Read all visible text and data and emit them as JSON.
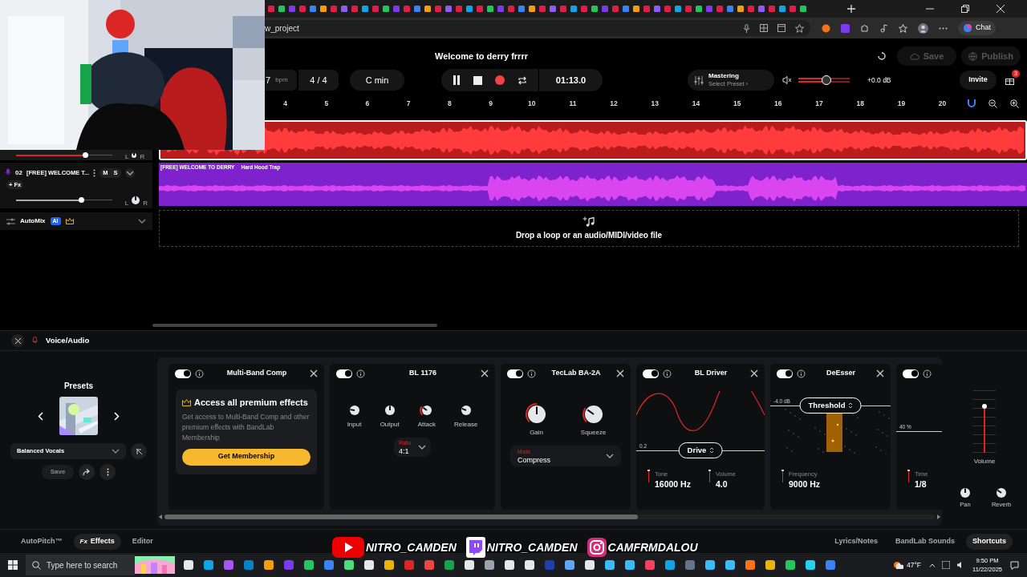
{
  "browser": {
    "address": "w_project",
    "chat": "Chat"
  },
  "project": {
    "title": "Welcome to derry frrrr",
    "save": "Save",
    "publish": "Publish"
  },
  "transport": {
    "tempo": "7",
    "tempo_unit": "bpm",
    "time_signature": "4 / 4",
    "key": "C min",
    "time": "01:13.0"
  },
  "mastering": {
    "title": "Mastering",
    "subtitle": "Select Preset ›"
  },
  "master_volume": {
    "level": 0.55,
    "reading": "+0.0 dB"
  },
  "invite": "Invite",
  "notifications": "3",
  "ruler": [
    "4",
    "5",
    "6",
    "7",
    "8",
    "9",
    "10",
    "11",
    "12",
    "13",
    "14",
    "15",
    "16",
    "17",
    "18",
    "19",
    "20"
  ],
  "tracks": [
    {
      "color": "#b91c1c",
      "selected": true,
      "volume": {
        "level": 0.72
      },
      "pan": [
        "L",
        "R"
      ]
    },
    {
      "color": "#7e22ce",
      "selected": false,
      "number": "02",
      "name": "[FREE] WELCOME T...",
      "mute": "M",
      "solo": "S",
      "fx": "+ Fx",
      "volume": {
        "level": 0.68
      },
      "pan": [
        "L",
        "R"
      ],
      "clip_title": "[FREE] WELCOME TO DERRY",
      "clip_subtitle": "Hard Hood Trap"
    }
  ],
  "automix": {
    "label": "AutoMix",
    "badge": "AI"
  },
  "drop_zone": "Drop a loop or an audio/MIDI/video file",
  "panel": {
    "title": "Voice/Audio"
  },
  "presets": {
    "title": "Presets",
    "selected": "Balanced Vocals",
    "save": "Save"
  },
  "effects": [
    {
      "kind": "premium",
      "name": "Multi-Band Comp",
      "on": true,
      "promo_title": "Access all premium effects",
      "promo_text": "Get access to Multi-Band Comp and other premium effects with BandLab Membership",
      "button": "Get Membership"
    },
    {
      "kind": "knobs",
      "name": "BL 1176",
      "on": true,
      "knobs": [
        {
          "label": "Input"
        },
        {
          "label": "Output"
        },
        {
          "label": "Attack"
        },
        {
          "label": "Release"
        }
      ],
      "select_label": "Ratio",
      "select_value": "4:1"
    },
    {
      "kind": "knobs",
      "name": "TecLab BA-2A",
      "on": true,
      "knobs": [
        {
          "label": "Gain"
        },
        {
          "label": "Squeeze"
        }
      ],
      "select_label": "Mode",
      "select_value": "Compress"
    },
    {
      "kind": "driver",
      "name": "BL Driver",
      "on": true,
      "reading": "0.2",
      "control": "Drive",
      "params": [
        {
          "label": "Tone",
          "value": "16000 Hz"
        },
        {
          "label": "Volume",
          "value": "4.0"
        }
      ]
    },
    {
      "kind": "deesser",
      "name": "DeEsser",
      "on": true,
      "reading": "-4.0 dB",
      "control": "Threshold",
      "params": [
        {
          "label": "Frequency",
          "value": "9000 Hz"
        }
      ]
    },
    {
      "kind": "partial",
      "on": true,
      "reading": "40 %",
      "params": [
        {
          "label": "Time",
          "value": "1/8"
        }
      ]
    }
  ],
  "channel": {
    "volume_label": "Volume",
    "volume": {
      "level": 0.75
    },
    "pan_label": "Pan",
    "reverb_label": "Reverb"
  },
  "bottom_tabs": [
    {
      "label": "AutoPitch™",
      "selected": false
    },
    {
      "label": "Effects",
      "prefix": "Fx",
      "selected": true
    },
    {
      "label": "Editor",
      "selected": false
    }
  ],
  "bottom_right": [
    {
      "label": "Lyrics/Notes",
      "selected": false
    },
    {
      "label": "BandLab Sounds",
      "selected": false
    },
    {
      "label": "Shortcuts",
      "selected": true
    }
  ],
  "socials": [
    {
      "kind": "youtube",
      "handle": "NITRO_CAMDEN"
    },
    {
      "kind": "twitch",
      "handle": "NITRO_CAMDEN"
    },
    {
      "kind": "instagram",
      "handle": "CAMFRMDALOU"
    }
  ],
  "taskbar": {
    "search_placeholder": "Type here to search",
    "weather": "47°F",
    "time": "9:50 PM",
    "date": "11/22/2025"
  }
}
